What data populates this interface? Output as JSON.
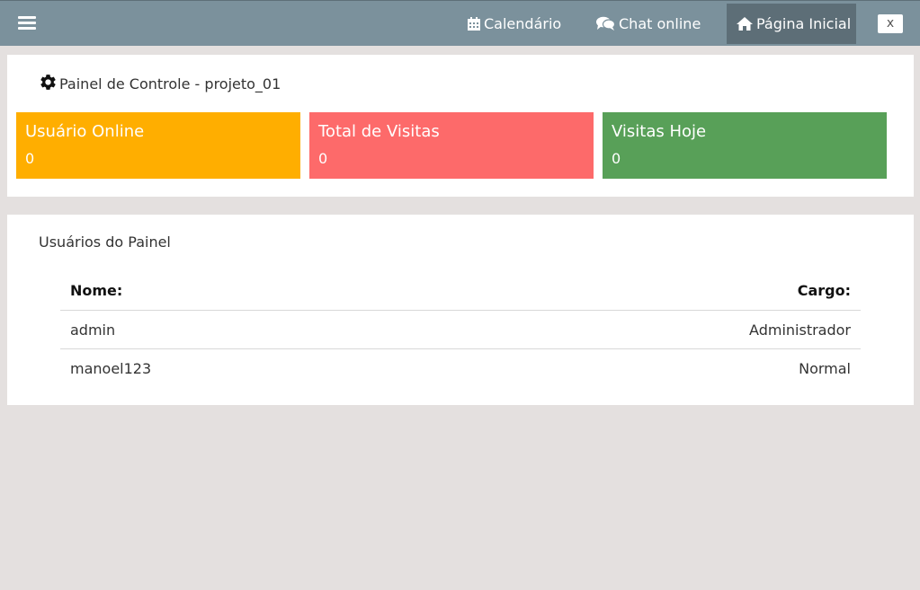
{
  "topbar": {
    "nav": [
      {
        "label": "Calendário",
        "icon": "calendar-icon"
      },
      {
        "label": "Chat online",
        "icon": "comments-icon"
      },
      {
        "label": "Página Inicial",
        "icon": "home-icon",
        "active": true
      }
    ],
    "close_label": "x",
    "color": "#7b919c",
    "active_color": "#5d6e77"
  },
  "dashboard": {
    "title": "Painel de Controle - projeto_01",
    "stats": [
      {
        "label": "Usuário Online",
        "value": "0",
        "color": "#ffae00"
      },
      {
        "label": "Total de Visitas",
        "value": "0",
        "color": "#fd6a6a"
      },
      {
        "label": "Visitas Hoje",
        "value": "0",
        "color": "#58a058"
      }
    ]
  },
  "users_panel": {
    "title": "Usuários do Painel",
    "columns": [
      "Nome:",
      "Cargo:"
    ],
    "rows": [
      {
        "nome": "admin",
        "cargo": "Administrador"
      },
      {
        "nome": "manoel123",
        "cargo": "Normal"
      }
    ]
  }
}
